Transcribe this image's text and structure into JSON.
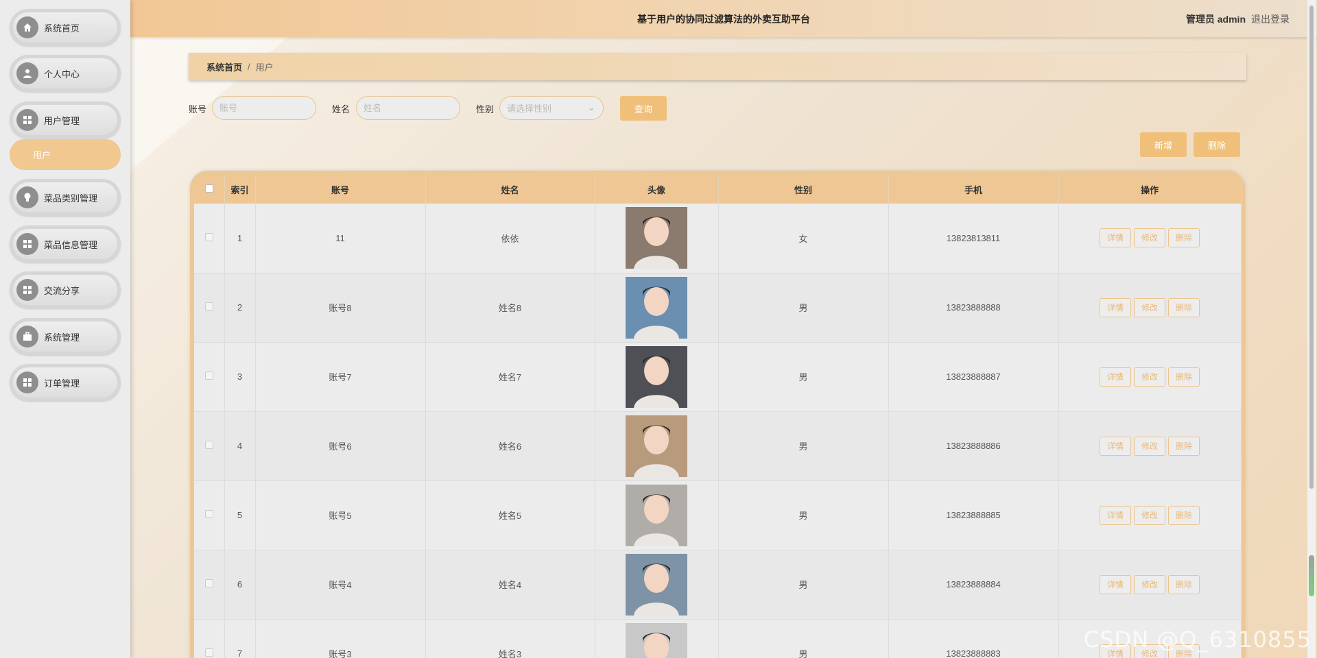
{
  "header": {
    "title": "基于用户的协同过滤算法的外卖互助平台",
    "user": "管理员 admin",
    "logout": "退出登录"
  },
  "sidebar": {
    "items": [
      {
        "label": "系统首页",
        "icon": "home-icon"
      },
      {
        "label": "个人中心",
        "icon": "user-icon"
      },
      {
        "label": "用户管理",
        "icon": "grid-icon"
      },
      {
        "label": "菜品类别管理",
        "icon": "bulb-icon"
      },
      {
        "label": "菜品信息管理",
        "icon": "grid-icon"
      },
      {
        "label": "交流分享",
        "icon": "grid-icon"
      },
      {
        "label": "系统管理",
        "icon": "briefcase-icon"
      },
      {
        "label": "订单管理",
        "icon": "grid-icon"
      }
    ],
    "sub_item": "用户"
  },
  "breadcrumb": {
    "home": "系统首页",
    "sep": "/",
    "current": "用户"
  },
  "search": {
    "account_label": "账号",
    "account_placeholder": "账号",
    "name_label": "姓名",
    "name_placeholder": "姓名",
    "gender_label": "性别",
    "gender_placeholder": "请选择性别",
    "query_button": "查询"
  },
  "actions": {
    "add": "新增",
    "delete": "删除"
  },
  "table": {
    "headers": [
      "索引",
      "账号",
      "姓名",
      "头像",
      "性别",
      "手机",
      "操作"
    ],
    "ops": {
      "detail": "详情",
      "edit": "修改",
      "delete": "删除"
    },
    "rows": [
      {
        "index": "1",
        "account": "11",
        "name": "依依",
        "gender": "女",
        "phone": "13823813811"
      },
      {
        "index": "2",
        "account": "账号8",
        "name": "姓名8",
        "gender": "男",
        "phone": "13823888888"
      },
      {
        "index": "3",
        "account": "账号7",
        "name": "姓名7",
        "gender": "男",
        "phone": "13823888887"
      },
      {
        "index": "4",
        "account": "账号6",
        "name": "姓名6",
        "gender": "男",
        "phone": "13823888886"
      },
      {
        "index": "5",
        "account": "账号5",
        "name": "姓名5",
        "gender": "男",
        "phone": "13823888885"
      },
      {
        "index": "6",
        "account": "账号4",
        "name": "姓名4",
        "gender": "男",
        "phone": "13823888884"
      },
      {
        "index": "7",
        "account": "账号3",
        "name": "姓名3",
        "gender": "男",
        "phone": "13823888883"
      }
    ]
  },
  "watermark": "CSDN @Q_6310855",
  "colors": {
    "accent": "#f0c07a",
    "accent_light": "#efc795",
    "sidebar_bg": "#ececec"
  }
}
